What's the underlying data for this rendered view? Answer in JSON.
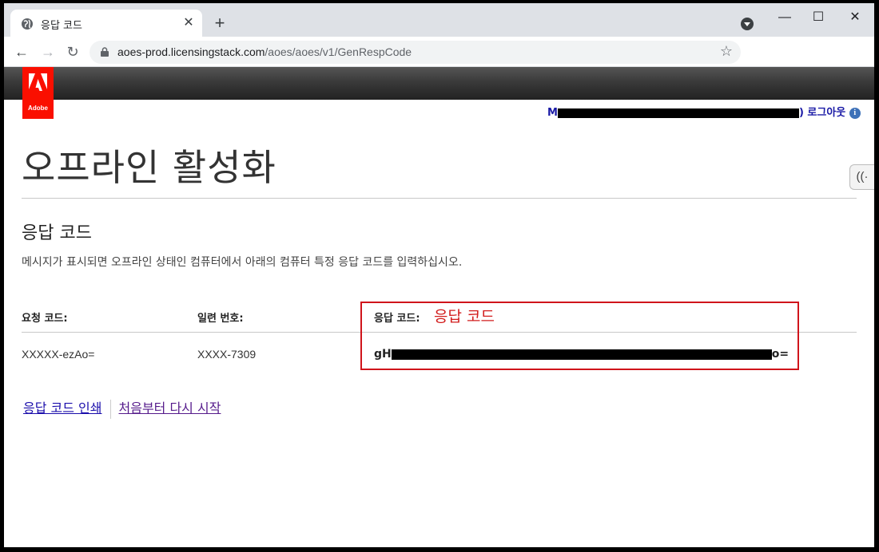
{
  "browser": {
    "tab_title": "응답 코드",
    "tab_close": "✕",
    "new_tab": "+",
    "url_host": "aoes-prod.licensingstack.com",
    "url_path": "/aoes/aoes/v1/GenRespCode",
    "controls": {
      "minimize": "—",
      "maximize": "☐",
      "close": "✕"
    },
    "nav": {
      "back": "←",
      "forward": "→",
      "reload": "↻",
      "star": "☆"
    }
  },
  "header": {
    "logo_text": "Adobe",
    "brand_color": "#fa0f00",
    "user_prefix": "M",
    "user_suffix": ")",
    "logout": "로그아웃",
    "info_glyph": "i",
    "help_glyph": "((·"
  },
  "main": {
    "title": "오프라인 활성화",
    "section_title": "응답 코드",
    "instructions": "메시지가 표시되면 오프라인 상태인 컴퓨터에서 아래의 컴퓨터 특정 응답 코드를 입력하십시오.",
    "columns": {
      "request_code_label": "요청 코드:",
      "serial_label": "일련 번호:",
      "response_code_label": "응답 코드:"
    },
    "values": {
      "request_code": "XXXXX-ezAo=",
      "serial": "XXXX-7309",
      "response_prefix": "gH",
      "response_suffix": "o="
    },
    "annotation": "응답 코드",
    "annotation_color": "#d21c1c",
    "links": {
      "print": "응답 코드 인쇄",
      "restart": "처음부터 다시 시작"
    }
  }
}
